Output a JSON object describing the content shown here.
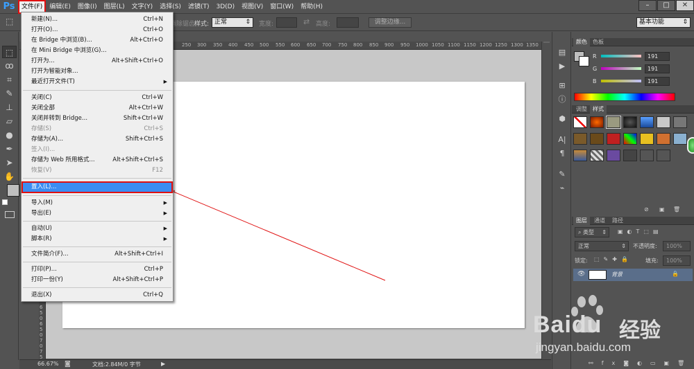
{
  "app": {
    "logo": "Ps"
  },
  "menubar": {
    "items": [
      "文件(F)",
      "编辑(E)",
      "图像(I)",
      "图层(L)",
      "文字(Y)",
      "选择(S)",
      "滤镜(T)",
      "3D(D)",
      "视图(V)",
      "窗口(W)",
      "帮助(H)"
    ],
    "window_buttons": [
      "–",
      "□",
      "✕"
    ]
  },
  "options": {
    "feather_label": "消除锯齿",
    "style_label": "样式:",
    "style_value": "正常",
    "width_label": "宽度:",
    "height_label": "高度:",
    "refine_edge": "调整边缘...",
    "workspace": "基本功能"
  },
  "file_menu": {
    "items": [
      {
        "label": "新建(N)...",
        "shortcut": "Ctrl+N"
      },
      {
        "label": "打开(O)...",
        "shortcut": "Ctrl+O"
      },
      {
        "label": "在 Bridge 中浏览(B)...",
        "shortcut": "Alt+Ctrl+O"
      },
      {
        "label": "在 Mini Bridge 中浏览(G)...",
        "shortcut": ""
      },
      {
        "label": "打开为...",
        "shortcut": "Alt+Shift+Ctrl+O"
      },
      {
        "label": "打开为智能对象...",
        "shortcut": ""
      },
      {
        "label": "最近打开文件(T)",
        "shortcut": ""
      },
      {
        "label": "关闭(C)",
        "shortcut": "Ctrl+W"
      },
      {
        "label": "关闭全部",
        "shortcut": "Alt+Ctrl+W"
      },
      {
        "label": "关闭并转到 Bridge...",
        "shortcut": "Shift+Ctrl+W"
      },
      {
        "label": "存储(S)",
        "shortcut": "Ctrl+S"
      },
      {
        "label": "存储为(A)...",
        "shortcut": "Shift+Ctrl+S"
      },
      {
        "label": "签入(I)...",
        "shortcut": ""
      },
      {
        "label": "存储为 Web 所用格式...",
        "shortcut": "Alt+Shift+Ctrl+S"
      },
      {
        "label": "恢复(V)",
        "shortcut": "F12"
      },
      {
        "label": "置入(L)...",
        "shortcut": ""
      },
      {
        "label": "导入(M)",
        "shortcut": ""
      },
      {
        "label": "导出(E)",
        "shortcut": ""
      },
      {
        "label": "自动(U)",
        "shortcut": ""
      },
      {
        "label": "脚本(R)",
        "shortcut": ""
      },
      {
        "label": "文件简介(F)...",
        "shortcut": "Alt+Shift+Ctrl+I"
      },
      {
        "label": "打印(P)...",
        "shortcut": "Ctrl+P"
      },
      {
        "label": "打印一份(Y)",
        "shortcut": "Alt+Shift+Ctrl+P"
      },
      {
        "label": "退出(X)",
        "shortcut": "Ctrl+Q"
      }
    ]
  },
  "ruler": {
    "top": [
      "250",
      "300",
      "350",
      "400",
      "450",
      "500",
      "550",
      "600",
      "650",
      "700",
      "750",
      "800",
      "850",
      "900",
      "950",
      "1000",
      "1050",
      "1100",
      "1150",
      "1200",
      "1250",
      "1300",
      "1350",
      "1400"
    ],
    "left": [
      "6",
      "5",
      "0",
      "6",
      "5",
      "0",
      "7",
      "0",
      "7",
      "5",
      "0"
    ]
  },
  "status": {
    "zoom": "66.67%",
    "doc_info": "文档:2.84M/0 字节"
  },
  "color_panel": {
    "tabs": [
      "颜色",
      "色板"
    ],
    "channels": [
      {
        "name": "R",
        "value": "191"
      },
      {
        "name": "G",
        "value": "191"
      },
      {
        "name": "B",
        "value": "191"
      }
    ]
  },
  "styles_panel": {
    "tabs": [
      "调整",
      "样式"
    ]
  },
  "layers_panel": {
    "tabs": [
      "图层",
      "通道",
      "路径"
    ],
    "filter_kind": "类型",
    "blend_mode": "正常",
    "opacity_label": "不透明度:",
    "opacity_value": "100%",
    "lock_label": "锁定:",
    "fill_label": "填充:",
    "fill_value": "100%",
    "layer_name": "背景"
  },
  "watermark": {
    "brand": "Baidu",
    "brand_cn": "经验",
    "url": "jingyan.baidu.com"
  },
  "colors": {
    "highlight": "#3b8df2",
    "annotation": "#e01010",
    "ps_blue": "#3aa0ff"
  }
}
